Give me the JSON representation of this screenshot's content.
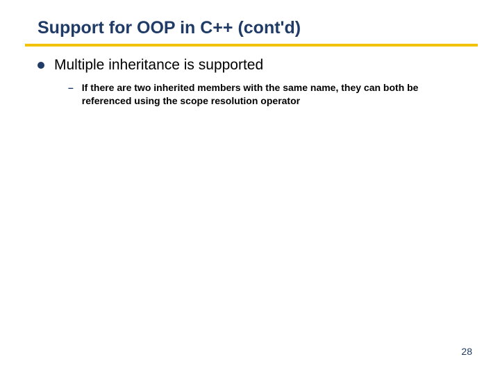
{
  "title": "Support for OOP in C++ (cont'd)",
  "bullets": [
    {
      "text": "Multiple inheritance is supported",
      "sub": [
        "If there are two inherited members with the same name, they can both be referenced using the scope resolution operator"
      ]
    }
  ],
  "page_number": "28",
  "colors": {
    "accent_rule": "#f2c200",
    "title_color": "#1f3b66"
  }
}
